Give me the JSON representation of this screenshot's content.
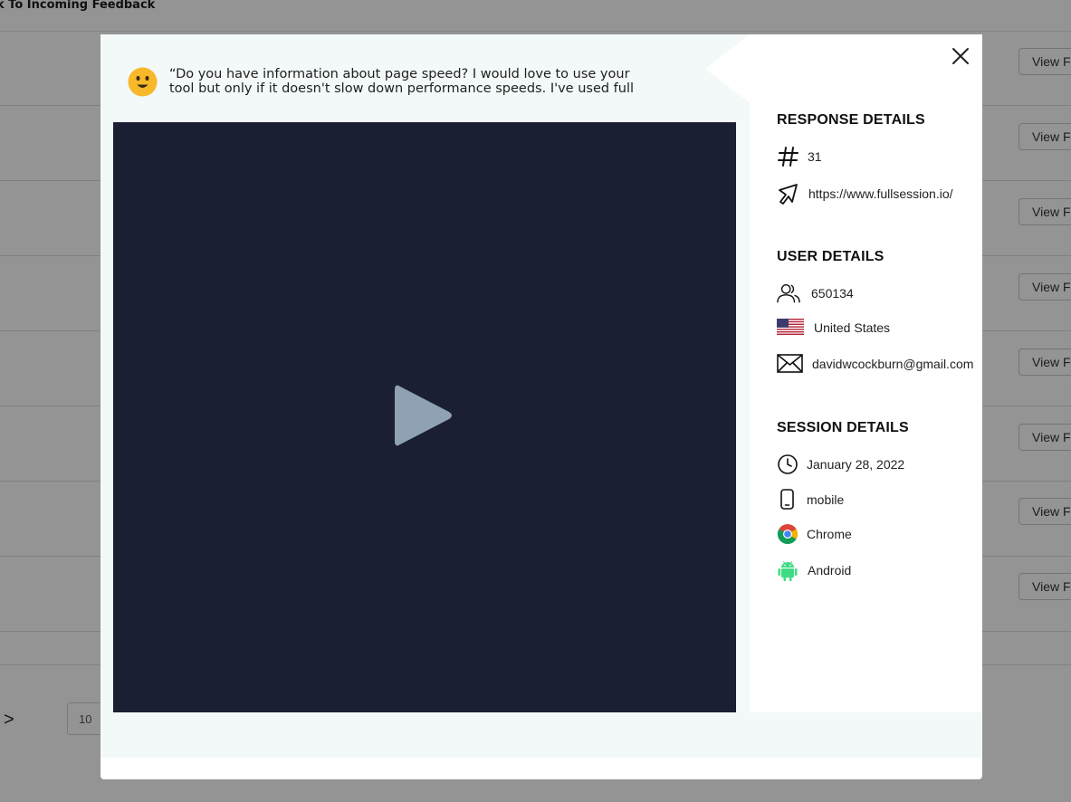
{
  "background": {
    "back_link": "k To Incoming Feedback",
    "row_button_label": "View F",
    "pager_next": ">",
    "page_size_value": "10"
  },
  "modal": {
    "quote": {
      "line1": "“Do you have information about page speed? I would love to use your",
      "line2": "tool but only if it doesn't slow down performance speeds. I've used full"
    },
    "emoji_icon": "smiling-face-icon",
    "response_details": {
      "title": "RESPONSE DETAILS",
      "id": "31",
      "url": "https://www.fullsession.io/"
    },
    "user_details": {
      "title": "USER DETAILS",
      "user_id": "650134",
      "country": "United States",
      "email": "davidwcockburn@gmail.com"
    },
    "session_details": {
      "title": "SESSION DETAILS",
      "date": "January 28, 2022",
      "device": "mobile",
      "browser": "Chrome",
      "os": "Android"
    }
  },
  "colors": {
    "video_bg": "#1b1f33",
    "play_icon": "#8fa1b3",
    "modal_tint": "#f3f8f8",
    "emoji": "#f7b829",
    "android": "#3ddc84"
  }
}
